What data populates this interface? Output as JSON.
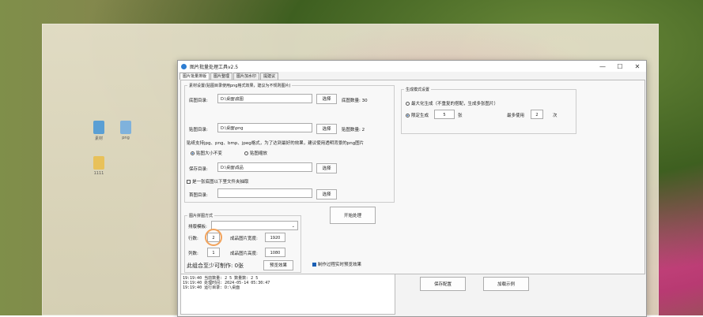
{
  "window": {
    "title": "图片批量处理工具v2.5",
    "controls": [
      "—",
      "☐",
      "✕"
    ]
  },
  "tabs": [
    "图片批量排版",
    "图片整理",
    "图片加水印",
    "提建议"
  ],
  "desktop_icons": [
    "素材",
    "png",
    "1111"
  ],
  "material": {
    "legend": "素材设置(贴图目录使用png格式效果，建议为不规则图片)",
    "bottom_dir_label": "底图目录:",
    "bottom_dir_value": "D:\\桌面\\底图",
    "bottom_count_label": "底图数量: 30",
    "sticker_dir_label": "贴图目录:",
    "sticker_dir_value": "D:\\桌面\\png",
    "sticker_count_label": "贴图数量: 2",
    "support_text": "贴纸支持jpg、png、bmp、jpeg格式，为了达到最好的效果，建议使用透明背景的png图片",
    "radio_keep": "贴图大小不变",
    "radio_scale": "贴图缩放",
    "save_dir_label": "保存目录:",
    "save_dir_value": "D:\\桌面\\成品",
    "checkbox_label": "是一张底图以下里文件夹抽取",
    "cover_dir_label": "首图目录:",
    "cover_dir_value": "",
    "choose_btn": "选择"
  },
  "generate": {
    "legend": "生成模式设置",
    "max_label": "最大化生成（不重复的搭配，生成多张图片）",
    "fixed_label": "限定生成",
    "fixed_value": "5",
    "fixed_unit": "张",
    "max_use_label": "最多使用",
    "max_use_value": "2",
    "max_use_unit": "次"
  },
  "start_btn": "开始处理",
  "layout": {
    "legend": "图片拼图方式",
    "template_label": "排版模板:",
    "rows_label": "行数:",
    "rows_value": "2",
    "cols_label": "列数:",
    "cols_value": "1",
    "width_label": "成品图片宽度:",
    "width_value": "1920",
    "height_label": "成品图片高度:",
    "height_value": "1080",
    "summary": "此组合至少可制作: 0张",
    "preview_btn": "预览效果",
    "realtime_label": "制作过程实时预览效果"
  },
  "log_lines": [
    "19:19:40 当前数量: 2 5 数量数: 2 5",
    "19:19:40 处理时间: 2024-05-14 05:30:47",
    "19:19:40 运行目录: D:\\桌面"
  ],
  "save_config_btn": "保存配置",
  "load_example_btn": "加载示例"
}
